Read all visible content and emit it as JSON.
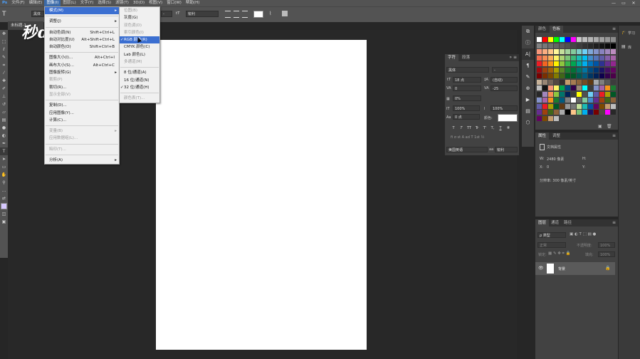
{
  "menubar": {
    "items": [
      "文件(F)",
      "编辑(E)",
      "图像(I)",
      "图层(L)",
      "文字(Y)",
      "选择(S)",
      "滤镜(T)",
      "3D(D)",
      "视图(V)",
      "窗口(W)",
      "帮助(H)"
    ],
    "controls": [
      "—",
      "▭",
      "✕"
    ]
  },
  "options": {
    "tool_icon": "T",
    "font_family": "黑体",
    "font_style": "-",
    "size_label": "tT",
    "antialias": "锐利"
  },
  "doc_tab": "未标题-1",
  "watermark": "秒dng视频",
  "image_menu": {
    "items": [
      {
        "label": "模式(M)",
        "shortcut": "",
        "arrow": "▸",
        "state": "hl"
      },
      {
        "sep": true
      },
      {
        "label": "调整(J)",
        "shortcut": "",
        "arrow": "▸",
        "state": ""
      },
      {
        "sep": true
      },
      {
        "label": "自动色调(N)",
        "shortcut": "Shift+Ctrl+L",
        "arrow": "",
        "state": ""
      },
      {
        "label": "自动对比度(U)",
        "shortcut": "Alt+Shift+Ctrl+L",
        "arrow": "",
        "state": ""
      },
      {
        "label": "自动颜色(O)",
        "shortcut": "Shift+Ctrl+B",
        "arrow": "",
        "state": ""
      },
      {
        "sep": true
      },
      {
        "label": "图像大小(I)...",
        "shortcut": "Alt+Ctrl+I",
        "arrow": "",
        "state": ""
      },
      {
        "label": "画布大小(S)...",
        "shortcut": "Alt+Ctrl+C",
        "arrow": "",
        "state": ""
      },
      {
        "label": "图像旋转(G)",
        "shortcut": "",
        "arrow": "▸",
        "state": ""
      },
      {
        "label": "裁剪(P)",
        "shortcut": "",
        "arrow": "",
        "state": "dis"
      },
      {
        "label": "裁切(R)...",
        "shortcut": "",
        "arrow": "",
        "state": ""
      },
      {
        "label": "显示全部(V)",
        "shortcut": "",
        "arrow": "",
        "state": "dis"
      },
      {
        "sep": true
      },
      {
        "label": "复制(D)...",
        "shortcut": "",
        "arrow": "",
        "state": ""
      },
      {
        "label": "应用图像(Y)...",
        "shortcut": "",
        "arrow": "",
        "state": ""
      },
      {
        "label": "计算(C)...",
        "shortcut": "",
        "arrow": "",
        "state": ""
      },
      {
        "sep": true
      },
      {
        "label": "变量(B)",
        "shortcut": "",
        "arrow": "▸",
        "state": "dis"
      },
      {
        "label": "应用数据组(L)...",
        "shortcut": "",
        "arrow": "",
        "state": "dis"
      },
      {
        "sep": true
      },
      {
        "label": "陷印(T)...",
        "shortcut": "",
        "arrow": "",
        "state": "dis"
      },
      {
        "sep": true
      },
      {
        "label": "分析(A)",
        "shortcut": "",
        "arrow": "▸",
        "state": ""
      }
    ]
  },
  "mode_menu": {
    "items": [
      {
        "label": "位图(B)",
        "check": "",
        "state": "dis"
      },
      {
        "label": "灰度(G)",
        "check": "",
        "state": ""
      },
      {
        "label": "双色调(D)",
        "check": "",
        "state": "dis"
      },
      {
        "label": "索引颜色(I)",
        "check": "",
        "state": "dis"
      },
      {
        "label": "RGB 颜色(R)",
        "check": "✓",
        "state": "hl"
      },
      {
        "label": "CMYK 颜色(C)",
        "check": "",
        "state": ""
      },
      {
        "label": "Lab 颜色(L)",
        "check": "",
        "state": ""
      },
      {
        "label": "多通道(M)",
        "check": "",
        "state": "dis"
      },
      {
        "sep": true
      },
      {
        "label": "8 位/通道(A)",
        "check": "",
        "state": ""
      },
      {
        "label": "16 位/通道(N)",
        "check": "",
        "state": ""
      },
      {
        "label": "32 位/通道(H)",
        "check": "✓",
        "state": ""
      },
      {
        "sep": true
      },
      {
        "label": "颜色表(T)...",
        "check": "",
        "state": "dis"
      }
    ]
  },
  "char_panel": {
    "tabs": [
      "字符",
      "段落"
    ],
    "font_family": "黑体",
    "font_style": "-",
    "size": "18 点",
    "leading": "(自动)",
    "kerning": "0",
    "tracking": "-25",
    "scale_pct": "0%",
    "vscale": "100%",
    "hscale": "100%",
    "baseline": "0 点",
    "color_label": "颜色:",
    "style_buttons": [
      "T",
      "T",
      "TT",
      "Tr",
      "T'",
      "T,",
      "T",
      "T"
    ],
    "language": "美国英语",
    "aa": "锐利"
  },
  "swatch_panel": {
    "tabs": [
      "颜色",
      "色板"
    ]
  },
  "props_panel": {
    "tabs": [
      "属性",
      "调整"
    ],
    "doc_props": "文档属性",
    "w_label": "W:",
    "w_val": "2480 像素",
    "h_label": "H:",
    "x_label": "X:",
    "x_val": "0",
    "y_label": "Y:",
    "resolution": "分辨率: 300 像素/英寸"
  },
  "layers_panel": {
    "tabs": [
      "图层",
      "通道",
      "路径"
    ],
    "filter_label": "ρ 类型",
    "blend": "正常",
    "opacity_label": "不透明度:",
    "opacity": "100%",
    "lock_label": "锁定:",
    "fill_label": "填充:",
    "fill": "100%",
    "layer_name": "背景"
  },
  "far_panel": {
    "learn": "学习",
    "lib": "库"
  },
  "colors": {
    "accent": "#3b6fd1",
    "swatch_rows": [
      [
        "#ffffff",
        "#ff0000",
        "#ffff00",
        "#00ff00",
        "#00ffff",
        "#0000ff",
        "#ff00ff",
        "#c8c8c8",
        "#bebebe",
        "#b4b4b4",
        "#aaaaaa",
        "#a0a0a0",
        "#969696",
        "#8c8c8c"
      ],
      [
        "#828282",
        "#787878",
        "#6e6e6e",
        "#646464",
        "#5a5a5a",
        "#505050",
        "#464646",
        "#3c3c3c",
        "#323232",
        "#282828",
        "#1e1e1e",
        "#141414",
        "#0a0a0a",
        "#000000"
      ],
      [
        "#f7977a",
        "#f9ad81",
        "#fdc68a",
        "#fff79a",
        "#c4df9b",
        "#a2d39c",
        "#82ca9d",
        "#7bcdc8",
        "#6ecff6",
        "#7ea7d8",
        "#8493ca",
        "#8882be",
        "#a187be",
        "#bc8dbf"
      ],
      [
        "#f26c4f",
        "#f68e55",
        "#fbaf5c",
        "#fff467",
        "#acd372",
        "#7cc576",
        "#3bb878",
        "#1abbb4",
        "#00bff3",
        "#438ccb",
        "#5574b9",
        "#605ca8",
        "#855fa8",
        "#a763a8"
      ],
      [
        "#ed1c24",
        "#f26522",
        "#f7941d",
        "#fff200",
        "#8dc63f",
        "#39b54a",
        "#00a651",
        "#00a99d",
        "#00aeef",
        "#0072bc",
        "#0054a6",
        "#2e3192",
        "#662d91",
        "#92278f"
      ],
      [
        "#9e0b0f",
        "#a0410d",
        "#a3620a",
        "#aba000",
        "#598527",
        "#1a7b30",
        "#007236",
        "#00746b",
        "#0076a3",
        "#004b80",
        "#003471",
        "#1b1464",
        "#440e62",
        "#630460"
      ],
      [
        "#790000",
        "#7b2e00",
        "#7d4900",
        "#827b00",
        "#406618",
        "#005e20",
        "#005826",
        "#005952",
        "#005b7f",
        "#003663",
        "#002157",
        "#0d004c",
        "#32004b",
        "#4b0049"
      ],
      [
        "#c7b299",
        "#998675",
        "#736357",
        "#534741",
        "#37302d",
        "#c69c6d",
        "#a67c52",
        "#8c6239",
        "#754c24",
        "#603913",
        "#a7a9ac",
        "#7f7f7f",
        "#595959",
        "#3c3c3c"
      ]
    ]
  }
}
